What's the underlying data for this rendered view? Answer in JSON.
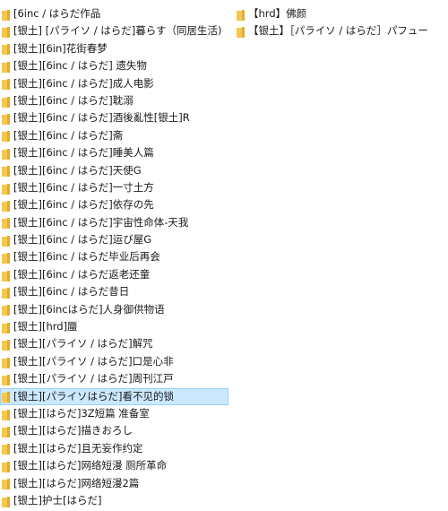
{
  "colors": {
    "folder": "#f4c74f",
    "folder_shade": "#e3ad2a",
    "selection_bg": "#cce8ff",
    "selection_border": "#99d1ff"
  },
  "left_column": [
    {
      "label": "[6inc / はらだ作品"
    },
    {
      "label": "[银土] [パライソ / はらだ]暮らす（同居生活)"
    },
    {
      "label": "[银土][6in]花街春梦"
    },
    {
      "label": "[银土][6inc / はらだ] 遗失物"
    },
    {
      "label": "[银土][6inc / はらだ]成人电影"
    },
    {
      "label": "[银土][6inc / はらだ]耽溺"
    },
    {
      "label": "[银土][6inc / はらだ]酒後亂性[银土]R"
    },
    {
      "label": "[银土][6inc / はらだ]斋"
    },
    {
      "label": "[银土][6inc / はらだ]睡美人篇"
    },
    {
      "label": "[银土][6inc / はらだ]天使G"
    },
    {
      "label": "[银土][6inc / はらだ]一寸土方"
    },
    {
      "label": "[银土][6inc / はらだ]依存の先"
    },
    {
      "label": "[银土][6inc / はらだ]宇宙性命体-天我"
    },
    {
      "label": "[银土][6inc / はらだ]运び屋G"
    },
    {
      "label": "[银土][6inc / はらだ毕业后再会"
    },
    {
      "label": "[银土][6inc / はらだ返老还童"
    },
    {
      "label": "[银土][6inc / はらだ昔日"
    },
    {
      "label": "[银土][6incはらだ]人身御供物语"
    },
    {
      "label": "[银土][hrd]蜃"
    },
    {
      "label": "[银土][パライソ / はらだ]解咒"
    },
    {
      "label": "[银土][パライソ / はらだ]口是心非"
    },
    {
      "label": "[银土][パライソ / はらだ]周刊江戸"
    },
    {
      "label": "[银土][パライソはらだ]看不见的锁",
      "selected": true
    },
    {
      "label": "[银土][はらだ]3Z短篇 准备室"
    },
    {
      "label": "[银土][はらだ]描きおろし"
    },
    {
      "label": "[银土][はらだ]且无妄作约定"
    },
    {
      "label": "[银土][はらだ]网络短漫 厕所革命"
    },
    {
      "label": "[银土][はらだ]网络短漫2篇"
    },
    {
      "label": "[银土]护士[はらだ]"
    }
  ],
  "right_column": [
    {
      "label": "【hrd】佛颜"
    },
    {
      "label": "【银土】［パライソ / はらだ］パフュー"
    }
  ]
}
